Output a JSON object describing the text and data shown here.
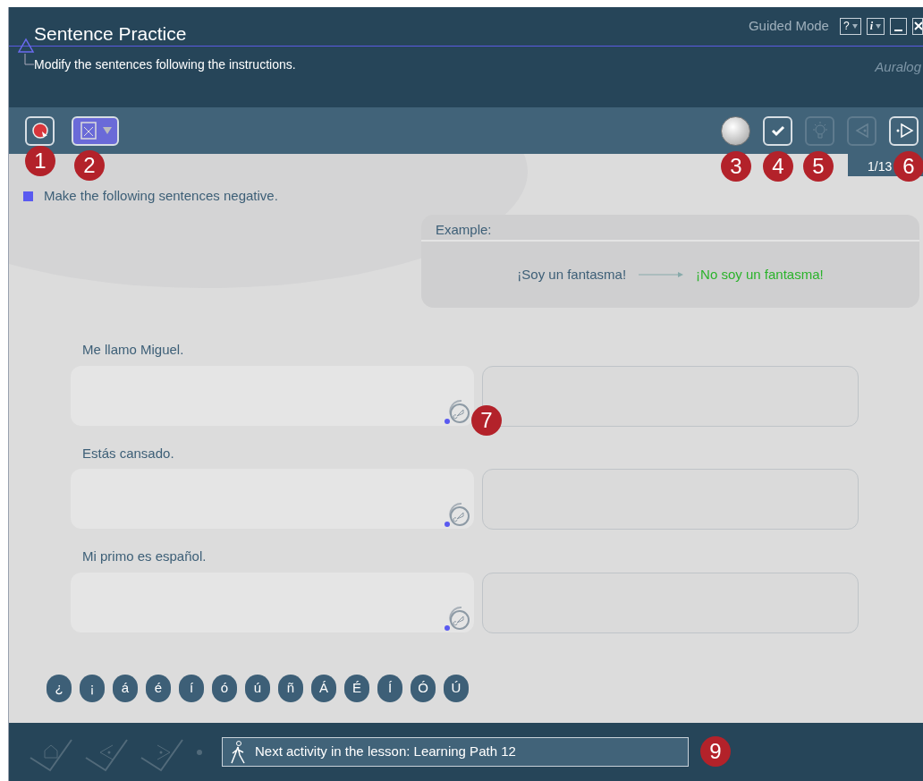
{
  "window": {
    "title": "Sentence Practice",
    "mode": "Guided Mode",
    "subtitle": "Modify the sentences following the instructions.",
    "logo": "Auralog",
    "controls": [
      {
        "kind": "help",
        "label": "?"
      },
      {
        "kind": "info",
        "label": "i"
      },
      {
        "kind": "minimize"
      },
      {
        "kind": "close"
      }
    ]
  },
  "toolbar": {
    "left": [
      {
        "kind": "record",
        "disabled": false
      },
      {
        "kind": "dictionary",
        "disabled": false
      }
    ],
    "right": [
      {
        "kind": "status",
        "disabled": false
      },
      {
        "kind": "check",
        "disabled": false
      },
      {
        "kind": "hint",
        "disabled": true
      },
      {
        "kind": "back",
        "disabled": true
      },
      {
        "kind": "next",
        "disabled": false
      }
    ],
    "counter": "1/13"
  },
  "instruction": "Make the following sentences negative.",
  "example": {
    "label": "Example:",
    "source": "¡Soy un fantasma!",
    "target": "¡No soy un fantasma!"
  },
  "exercises": [
    {
      "prompt": "Me llamo Miguel."
    },
    {
      "prompt": "Estás cansado."
    },
    {
      "prompt": "Mi primo es español."
    }
  ],
  "keys": [
    "¿",
    "¡",
    "á",
    "é",
    "í",
    "ó",
    "ú",
    "ñ",
    "Á",
    "É",
    "Í",
    "Ó",
    "Ú"
  ],
  "footer": {
    "nav": [
      {
        "kind": "home",
        "disabled": true
      },
      {
        "kind": "back",
        "disabled": true
      },
      {
        "kind": "next",
        "disabled": true
      }
    ],
    "next_activity": "Next activity in the lesson: Learning Path 12"
  },
  "callouts": [
    {
      "label": "1"
    },
    {
      "label": "2"
    },
    {
      "label": "3"
    },
    {
      "label": "4"
    },
    {
      "label": "5"
    },
    {
      "label": "6"
    },
    {
      "label": "7"
    },
    {
      "label": "9"
    }
  ]
}
